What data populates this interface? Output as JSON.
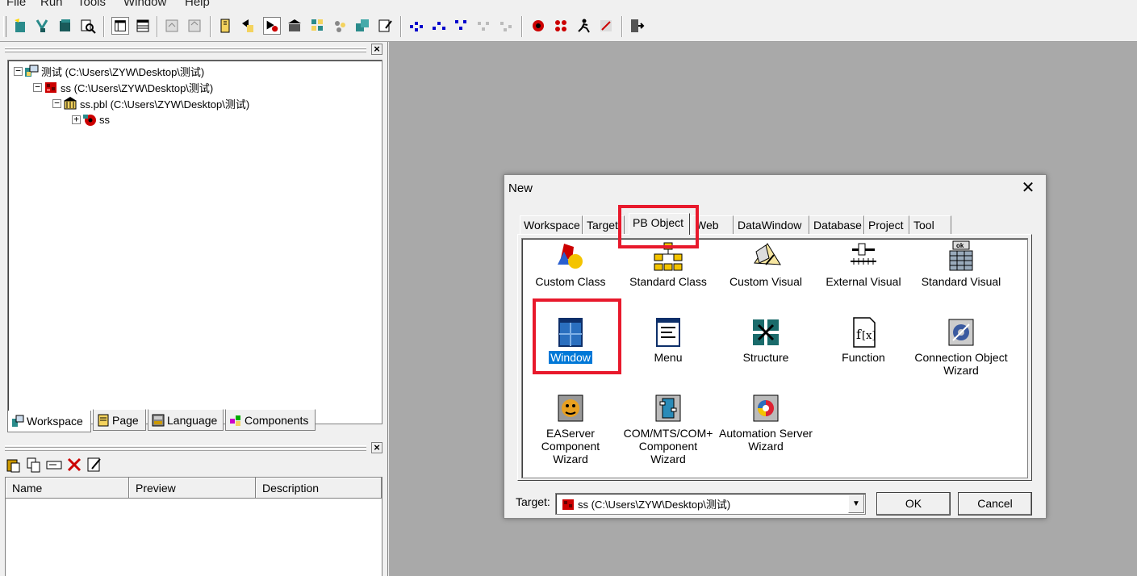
{
  "menu": [
    "File",
    "Run",
    "Tools",
    "Window",
    "Help"
  ],
  "toolbar_icons": [
    "new-icon",
    "inherit-icon",
    "open-icon",
    "preview-icon",
    "layout-icon",
    "grid-icon",
    "close-all-icon",
    "stack-icon",
    "library-icon",
    "build-icon",
    "run-icon",
    "stop-icon",
    "debug-icon",
    "select-icon",
    "edit-icon",
    "deploy-icon",
    "dist-icon",
    "gen-icon",
    "api-icon",
    "migrate-icon",
    "regen-icon",
    "bug-icon",
    "profile-icon",
    "runner-icon",
    "flag-icon",
    "exit-icon"
  ],
  "workspace_tree": [
    {
      "label": "测试 (C:\\Users\\ZYW\\Desktop\\测试)",
      "expander": "−"
    },
    {
      "label": "ss (C:\\Users\\ZYW\\Desktop\\测试)",
      "expander": "−"
    },
    {
      "label": "ss.pbl (C:\\Users\\ZYW\\Desktop\\测试)",
      "expander": "−"
    },
    {
      "label": "ss",
      "expander": "+"
    }
  ],
  "pane_tabs": [
    "Workspace",
    "Page",
    "Language",
    "Components"
  ],
  "list_headers": [
    "Name",
    "Preview",
    "Description"
  ],
  "dialog": {
    "title": "New",
    "close": "✕",
    "tabs": [
      "Workspace",
      "Target",
      "PB Object",
      "Web",
      "DataWindow",
      "Database",
      "Project",
      "Tool"
    ],
    "active_tab": "PB Object",
    "items": [
      {
        "label": "Custom Class"
      },
      {
        "label": "Standard Class"
      },
      {
        "label": "Custom Visual"
      },
      {
        "label": "External Visual"
      },
      {
        "label": "Standard Visual"
      },
      {
        "label": "Window"
      },
      {
        "label": "Menu"
      },
      {
        "label": "Structure"
      },
      {
        "label": "Function"
      },
      {
        "label": "Connection Object Wizard"
      },
      {
        "label": "EAServer Component Wizard"
      },
      {
        "label": "COM/MTS/COM+ Component Wizard"
      },
      {
        "label": "Automation Server Wizard"
      }
    ],
    "selected_item": "Window",
    "target_label": "Target:",
    "target_value": "ss (C:\\Users\\ZYW\\Desktop\\测试)",
    "ok": "OK",
    "cancel": "Cancel"
  },
  "colors": {
    "highlight": "#e8192c",
    "selection": "#0078d7",
    "mdi_background": "#a9a9a9"
  }
}
